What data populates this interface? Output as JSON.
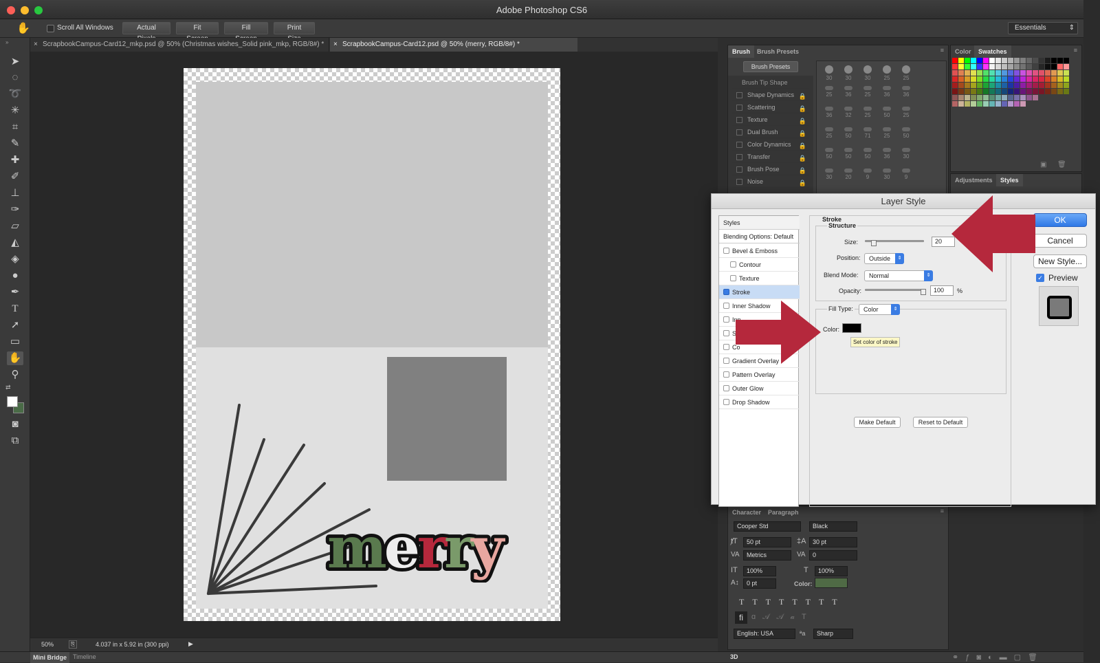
{
  "app": {
    "title": "Adobe Photoshop CS6",
    "workspace": "Essentials"
  },
  "options": {
    "scroll_all_label": "Scroll All Windows",
    "buttons": [
      "Actual Pixels",
      "Fit Screen",
      "Fill Screen",
      "Print Size"
    ]
  },
  "tabs": [
    {
      "label": "ScrapbookCampus-Card12_mkp.psd @ 50% (Christmas wishes_Solid pink_mkp, RGB/8#) *"
    },
    {
      "label": "ScrapbookCampus-Card12.psd @ 50% (merry, RGB/8#) *"
    }
  ],
  "canvas": {
    "text": "merry"
  },
  "status": {
    "zoom": "50%",
    "doc_info": "4.037 in x 5.92 in (300 ppi)"
  },
  "bottom": {
    "mini_bridge": "Mini Bridge",
    "timeline": "Timeline",
    "three_d": "3D"
  },
  "brush": {
    "tab_brush": "Brush",
    "tab_presets": "Brush Presets",
    "presets_button": "Brush Presets",
    "options": [
      "Brush Tip Shape",
      "Shape Dynamics",
      "Scattering",
      "Texture",
      "Dual Brush",
      "Color Dynamics",
      "Transfer",
      "Brush Pose",
      "Noise"
    ],
    "sizes": [
      "30",
      "30",
      "30",
      "25",
      "25",
      "25",
      "36",
      "25",
      "36",
      "36",
      "36",
      "32",
      "25",
      "50",
      "25",
      "25",
      "50",
      "71",
      "25",
      "50",
      "50",
      "50",
      "50",
      "36",
      "30",
      "30",
      "20",
      "9",
      "30",
      "9"
    ]
  },
  "color": {
    "tab_color": "Color",
    "tab_swatches": "Swatches"
  },
  "adjust": {
    "tab_adjustments": "Adjustments",
    "tab_styles": "Styles"
  },
  "character": {
    "tab_character": "Character",
    "tab_paragraph": "Paragraph",
    "font": "Cooper Std",
    "style": "Black",
    "size": "50 pt",
    "leading": "30 pt",
    "kerning": "Metrics",
    "tracking": "0",
    "vscale": "100%",
    "hscale": "100%",
    "baseline": "0 pt",
    "color_label": "Color:",
    "language": "English: USA",
    "aa_label": "a",
    "antialias": "Sharp"
  },
  "dialog": {
    "title": "Layer Style",
    "styles_header": "Styles",
    "blending": "Blending Options: Default",
    "items": [
      "Bevel & Emboss",
      "Contour",
      "Texture",
      "Stroke",
      "Inner Shadow",
      "Inner Glow",
      "Satin",
      "Color Overlay",
      "Gradient Overlay",
      "Pattern Overlay",
      "Outer Glow",
      "Drop Shadow"
    ],
    "items_visible": [
      "Bevel & Emboss",
      "Contour",
      "Texture",
      "Stroke",
      "Inner Shadow",
      "Inn",
      "Sa",
      "Co",
      "Gradient Overlay",
      "Pattern Overlay",
      "Outer Glow",
      "Drop Shadow"
    ],
    "stroke_title": "Stroke",
    "structure_title": "Structure",
    "size_label": "Size:",
    "size_value": "20",
    "position_label": "Position:",
    "position_value": "Outside",
    "blend_label": "Blend Mode:",
    "blend_value": "Normal",
    "opacity_label": "Opacity:",
    "opacity_value": "100",
    "opacity_unit": "%",
    "filltype_label": "Fill Type:",
    "filltype_value": "Color",
    "color_label": "Color:",
    "tooltip": "Set color of stroke",
    "make_default": "Make Default",
    "reset_default": "Reset to Default",
    "ok": "OK",
    "cancel": "Cancel",
    "new_style": "New Style...",
    "preview": "Preview",
    "stroke_color": "#000000"
  },
  "colors": {
    "accent": "#3a7ce3",
    "arrow": "#b5283c",
    "merry_green": "#5a7a4e",
    "merry_red": "#b5283c",
    "merry_pink": "#e8a7a0",
    "merry_sage": "#7a9a6a"
  }
}
